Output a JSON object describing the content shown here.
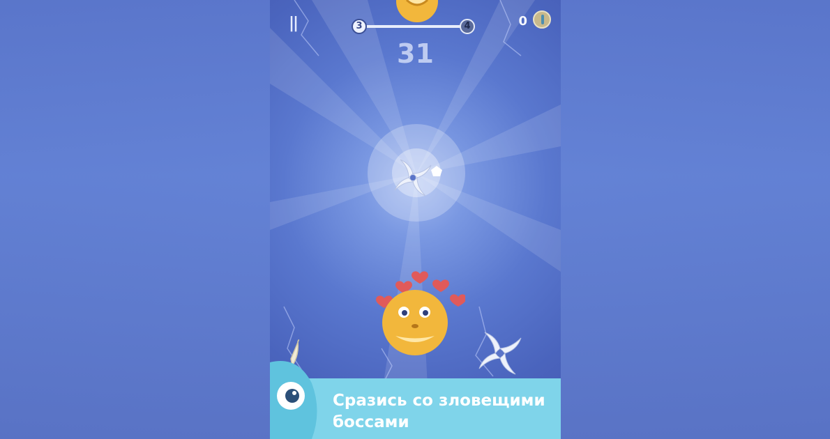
{
  "hud": {
    "pause_label": "||",
    "current_level": "3",
    "next_level": "4",
    "level_progress": 0.0,
    "score": "31",
    "coin_count": "0",
    "coin_icon": "feather-coin-icon"
  },
  "scene": {
    "boss": "fluffy-yellow-boss",
    "player": "fluffy-yellow-creature",
    "hearts": 5,
    "projectiles": [
      "shuriken",
      "shuriken"
    ],
    "gem": "white-gem"
  },
  "banner": {
    "text": "Сразись со зловещими боссами",
    "background": "#7fd4ea"
  },
  "colors": {
    "sky_center": "#9fb7ef",
    "sky_edge": "#4559b0",
    "heart": "#e05a5a",
    "creature": "#f2b73c"
  }
}
